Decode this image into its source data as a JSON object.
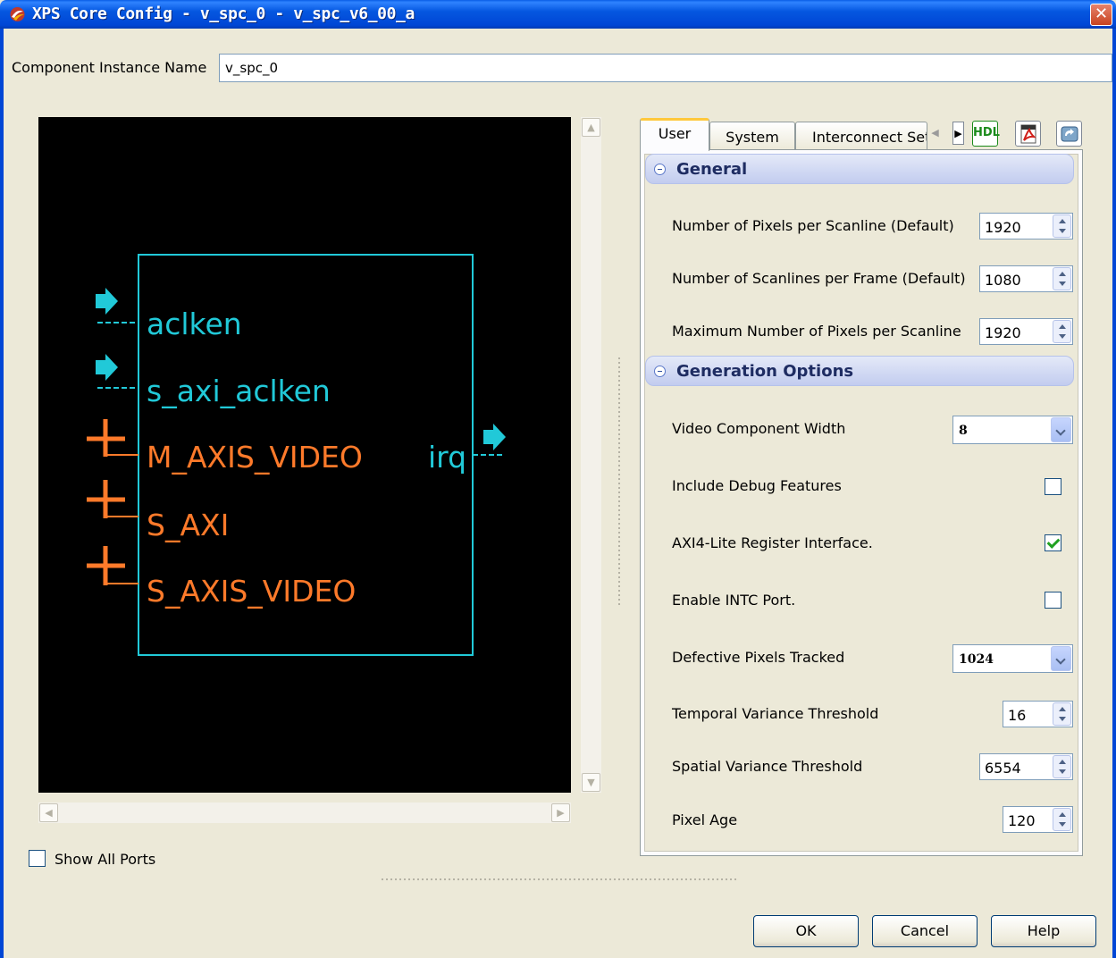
{
  "window": {
    "title": "XPS Core Config - v_spc_0 - v_spc_v6_00_a",
    "close_glyph": "✕"
  },
  "instance": {
    "label": "Component Instance Name",
    "value": "v_spc_0"
  },
  "diagram": {
    "ports_left": [
      {
        "name": "aclken",
        "kind": "clock-enable",
        "color": "#21c9d8"
      },
      {
        "name": "s_axi_aclken",
        "kind": "clock-enable",
        "color": "#21c9d8"
      },
      {
        "name": "M_AXIS_VIDEO",
        "kind": "bus",
        "color": "#ff7a2a"
      },
      {
        "name": "S_AXI",
        "kind": "bus",
        "color": "#ff7a2a"
      },
      {
        "name": "S_AXIS_VIDEO",
        "kind": "bus",
        "color": "#ff7a2a"
      }
    ],
    "ports_right": [
      {
        "name": "irq",
        "kind": "output",
        "color": "#21c9d8"
      }
    ]
  },
  "show_all_ports": {
    "label": "Show All Ports",
    "checked": false
  },
  "tabs": [
    {
      "label": "User",
      "active": true
    },
    {
      "label": "System",
      "active": false
    },
    {
      "label": "Interconnect Set",
      "active": false
    }
  ],
  "toolbar": {
    "hdl_label": "HDL",
    "pdf_icon": "pdf-icon",
    "refresh_icon": "refresh-icon"
  },
  "sections": {
    "general": {
      "title": "General",
      "params": [
        {
          "label": "Number of Pixels per Scanline (Default)",
          "value": "1920"
        },
        {
          "label": "Number of Scanlines per Frame (Default)",
          "value": "1080"
        },
        {
          "label": "Maximum Number of Pixels per Scanline",
          "value": "1920"
        }
      ]
    },
    "generation": {
      "title": "Generation Options",
      "video_width": {
        "label": "Video Component Width",
        "value": "8"
      },
      "debug": {
        "label": "Include Debug Features",
        "checked": false
      },
      "axi_lite": {
        "label": "AXI4-Lite Register Interface.",
        "checked": true
      },
      "intc": {
        "label": "Enable INTC Port.",
        "checked": false
      },
      "defective": {
        "label": "Defective Pixels Tracked",
        "value": "1024"
      },
      "temporal": {
        "label": "Temporal Variance Threshold",
        "value": "16"
      },
      "spatial": {
        "label": "Spatial Variance Threshold",
        "value": "6554"
      },
      "age": {
        "label": "Pixel Age",
        "value": "120"
      }
    }
  },
  "buttons": {
    "ok": "OK",
    "cancel": "Cancel",
    "help": "Help"
  }
}
